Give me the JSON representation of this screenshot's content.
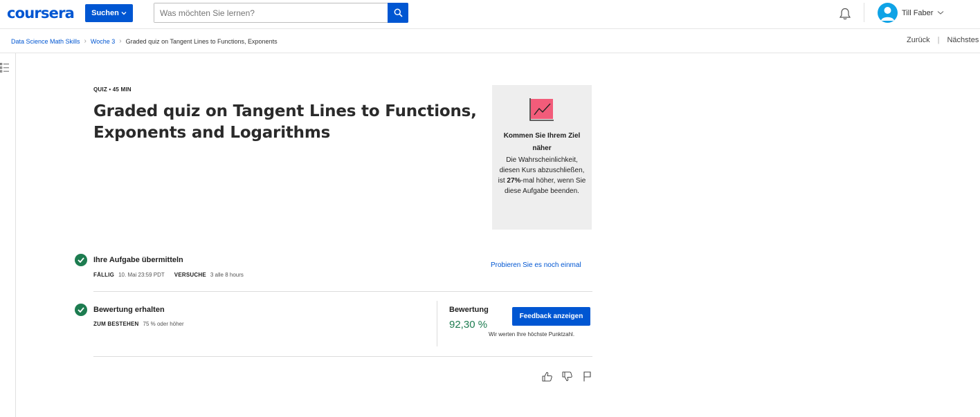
{
  "header": {
    "logo_text": "coursera",
    "search_button_label": "Suchen",
    "search_placeholder": "Was möchten Sie lernen?",
    "user_name": "Till Faber"
  },
  "breadcrumb": {
    "items": [
      "Data Science Math Skills",
      "Woche 3"
    ],
    "current": "Graded quiz on Tangent Lines to Functions, Exponents"
  },
  "nav": {
    "back": "Zurück",
    "next": "Nächstes"
  },
  "quiz": {
    "eyebrow": "QUIZ • 45 MIN",
    "title": "Graded quiz on Tangent Lines to Functions, Exponents and Logarithms"
  },
  "goal_card": {
    "title": "Kommen Sie Ihrem Ziel näher",
    "text_before": "Die Wahrscheinlichkeit, diesen Kurs abzuschließen, ist ",
    "highlight": "27%",
    "text_after": "-mal höher, wenn Sie diese Aufgabe beenden."
  },
  "submit_section": {
    "title": "Ihre Aufgabe übermitteln",
    "due_label": "FÄLLIG",
    "due_value": "10. Mai 23:59 PDT",
    "attempts_label": "VERSUCHE",
    "attempts_value": "3 alle 8 hours",
    "retry_link": "Probieren Sie es noch einmal"
  },
  "grade_section": {
    "title": "Bewertung erhalten",
    "pass_label": "ZUM BESTEHEN",
    "pass_value": "75 % oder höher",
    "grade_label": "Bewertung",
    "grade_value": "92,30 %",
    "feedback_button": "Feedback anzeigen",
    "highest_note": "Wir werten Ihre höchste Punktzahl."
  },
  "colors": {
    "brand_blue": "#0056d2",
    "success_green": "#1d7c50",
    "goal_card_bg": "#eeeeee",
    "chart_icon_pink": "#f25c7a"
  }
}
